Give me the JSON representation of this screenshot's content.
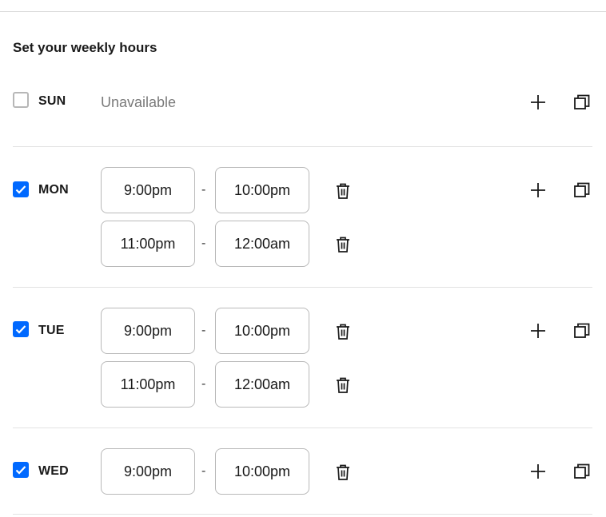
{
  "title": "Set your weekly hours",
  "days": {
    "sun": {
      "label": "SUN",
      "checked": false,
      "status": "Unavailable",
      "intervals": []
    },
    "mon": {
      "label": "MON",
      "checked": true,
      "intervals": [
        {
          "start": "9:00pm",
          "end": "10:00pm"
        },
        {
          "start": "11:00pm",
          "end": "12:00am"
        }
      ]
    },
    "tue": {
      "label": "TUE",
      "checked": true,
      "intervals": [
        {
          "start": "9:00pm",
          "end": "10:00pm"
        },
        {
          "start": "11:00pm",
          "end": "12:00am"
        }
      ]
    },
    "wed": {
      "label": "WED",
      "checked": true,
      "intervals": [
        {
          "start": "9:00pm",
          "end": "10:00pm"
        }
      ]
    }
  },
  "separator": "-",
  "icons": {
    "add": "plus-icon",
    "copy": "copy-icon",
    "delete": "trash-icon",
    "check": "checkmark-icon"
  },
  "colors": {
    "accent": "#0069ff",
    "border": "#b9b9b9",
    "text": "#1a1a1a",
    "muted": "#7a7a7a"
  }
}
